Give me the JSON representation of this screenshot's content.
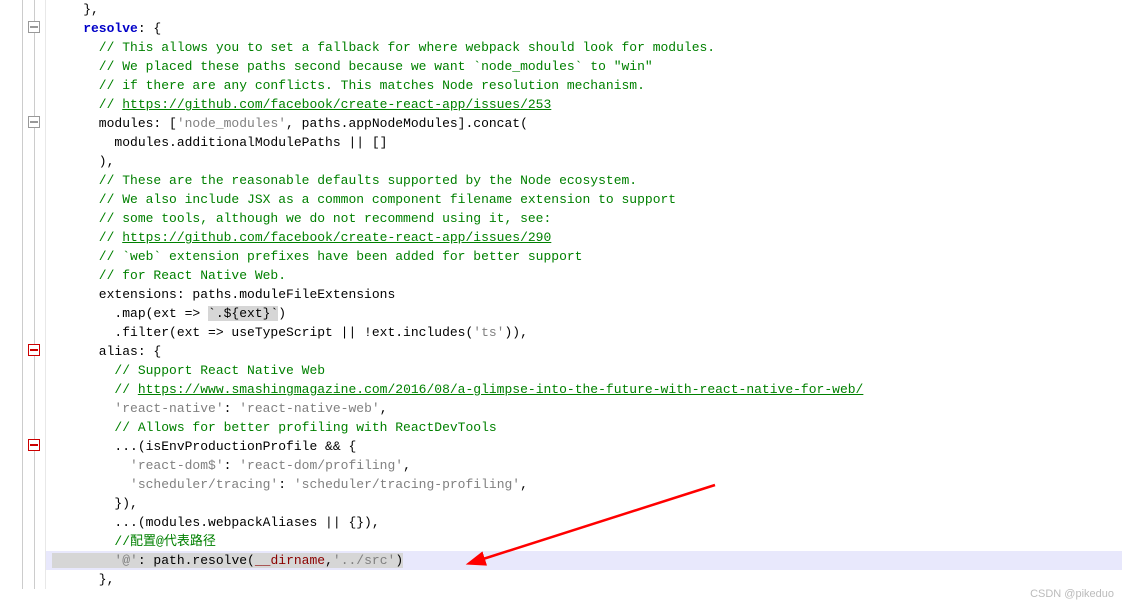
{
  "code": {
    "l0": "    },",
    "l1_key": "    resolve",
    "l1_after": ": {",
    "l2": "      // This allows you to set a fallback for where webpack should look for modules.",
    "l3": "      // We placed these paths second because we want `node_modules` to \"win\"",
    "l4": "      // if there are any conflicts. This matches Node resolution mechanism.",
    "l5a": "      // ",
    "l5b": "https://github.com/facebook/create-react-app/issues/253",
    "l6a": "      modules: [",
    "l6b": "'node_modules'",
    "l6c": ", paths.appNodeModules].concat(",
    "l7": "        modules.additionalModulePaths || []",
    "l8": "      ),",
    "l9": "      // These are the reasonable defaults supported by the Node ecosystem.",
    "l10": "      // We also include JSX as a common component filename extension to support",
    "l11": "      // some tools, although we do not recommend using it, see:",
    "l12a": "      // ",
    "l12b": "https://github.com/facebook/create-react-app/issues/290",
    "l13": "      // `web` extension prefixes have been added for better support",
    "l14": "      // for React Native Web.",
    "l15": "      extensions: paths.moduleFileExtensions",
    "l16a": "        .map(ext => ",
    "l16b": "`.${ext}`",
    "l16c": ")",
    "l17a": "        .filter(ext => useTypeScript || !ext.includes(",
    "l17b": "'ts'",
    "l17c": ")),",
    "l18": "      alias: {",
    "l19": "        // Support React Native Web",
    "l20a": "        // ",
    "l20b": "https://www.smashingmagazine.com/2016/08/a-glimpse-into-the-future-with-react-native-for-web/",
    "l21a": "        'react-native'",
    "l21b": ": ",
    "l21c": "'react-native-web'",
    "l21d": ",",
    "l22": "        // Allows for better profiling with ReactDevTools",
    "l23": "        ...(isEnvProductionProfile && {",
    "l24a": "          'react-dom$'",
    "l24b": ": ",
    "l24c": "'react-dom/profiling'",
    "l24d": ",",
    "l25a": "          'scheduler/tracing'",
    "l25b": ": ",
    "l25c": "'scheduler/tracing-profiling'",
    "l25d": ",",
    "l26": "        }),",
    "l27": "        ...(modules.webpackAliases || {}),",
    "l28": "        //配置@代表路径",
    "l29a": "        '@'",
    "l29b": ": path.resolve(",
    "l29c": "__dirname",
    "l29d": ",",
    "l29e": "'../src'",
    "l29f": ")",
    "l30": "      },"
  },
  "watermark": "CSDN @pikeduo"
}
